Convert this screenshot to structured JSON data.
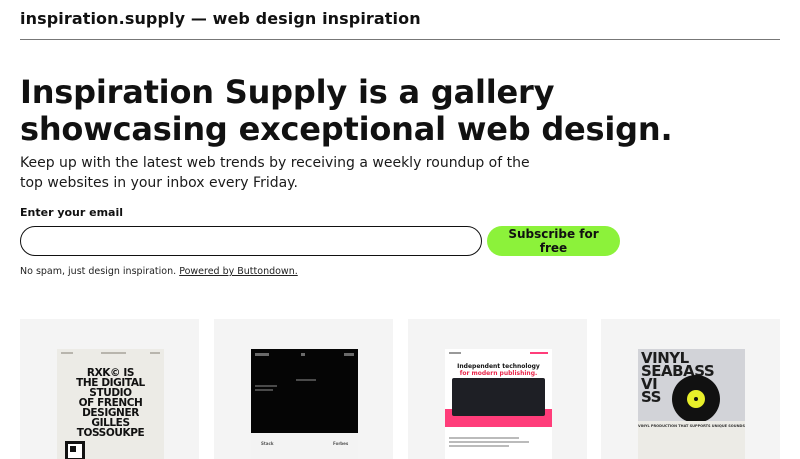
{
  "header": {
    "site_title": "inspiration.supply — web design inspiration"
  },
  "hero": {
    "title": "Inspiration Supply is a gallery showcasing exceptional web design.",
    "subtitle": "Keep up with the latest web trends by receiving a weekly roundup of the top websites in your inbox every Friday."
  },
  "signup": {
    "label": "Enter your email",
    "input_value": "",
    "input_placeholder": "",
    "button_label": "Subscribe for free",
    "fineprint": "No spam, just design inspiration.",
    "powered_link": "Powered by Buttondown."
  },
  "gallery": {
    "cards": [
      {
        "lines": [
          "RXK© IS",
          "THE DIGITAL STUDIO",
          "OF FRENCH DESIGNER",
          "GILLES TOSSOUKPE"
        ]
      },
      {
        "logos": [
          "Stack",
          "Forbes"
        ]
      },
      {
        "heading_dark": "Independent technology",
        "heading_red": "for modern publishing."
      },
      {
        "lines": [
          "VINYL",
          "SEABASS",
          "VI",
          "SS"
        ],
        "caption": "VINYL PRODUCTION THAT SUPPORTS UNIQUE SOUNDS"
      }
    ]
  },
  "colors": {
    "accent": "#8cf23a",
    "text": "#111111",
    "card_bg": "#f4f4f4"
  }
}
